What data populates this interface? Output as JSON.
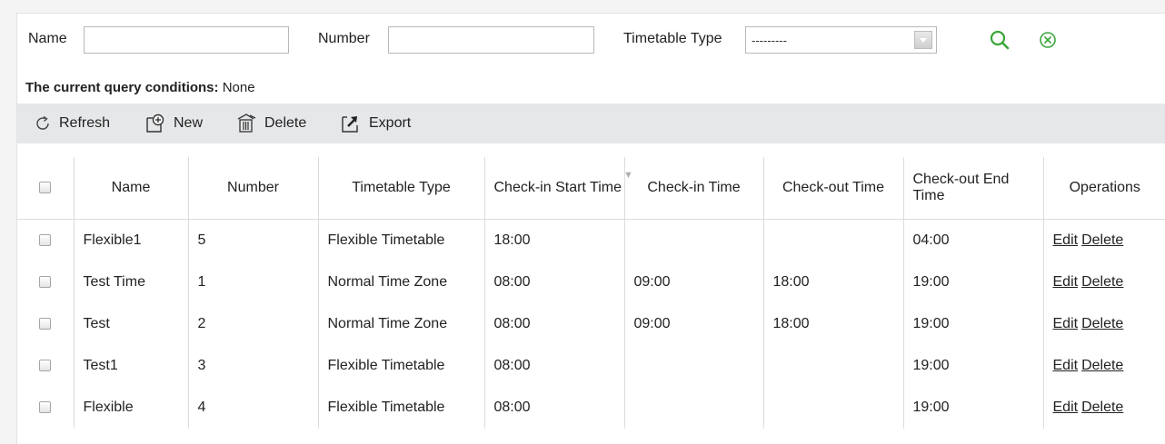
{
  "filters": {
    "name_label": "Name",
    "name_value": "",
    "number_label": "Number",
    "number_value": "",
    "timetable_type_label": "Timetable Type",
    "timetable_type_value": "---------"
  },
  "query_conditions": {
    "label": "The current query conditions:",
    "value": "None"
  },
  "toolbar": {
    "refresh": "Refresh",
    "new": "New",
    "delete": "Delete",
    "export": "Export"
  },
  "table": {
    "headers": {
      "name": "Name",
      "number": "Number",
      "timetable_type": "Timetable Type",
      "checkin_start": "Check-in Start Time",
      "checkin": "Check-in Time",
      "checkout": "Check-out Time",
      "checkout_end": "Check-out End Time",
      "operations": "Operations"
    },
    "rows": [
      {
        "name": "Flexible1",
        "number": "5",
        "type": "Flexible Timetable",
        "checkin_start": "18:00",
        "checkin": "",
        "checkout": "",
        "checkout_end": "04:00",
        "edit": "Edit",
        "delete": "Delete"
      },
      {
        "name": "Test Time",
        "number": "1",
        "type": "Normal Time Zone",
        "checkin_start": "08:00",
        "checkin": "09:00",
        "checkout": "18:00",
        "checkout_end": "19:00",
        "edit": "Edit",
        "delete": "Delete"
      },
      {
        "name": "Test",
        "number": "2",
        "type": "Normal Time Zone",
        "checkin_start": "08:00",
        "checkin": "09:00",
        "checkout": "18:00",
        "checkout_end": "19:00",
        "edit": "Edit",
        "delete": "Delete"
      },
      {
        "name": "Test1",
        "number": "3",
        "type": "Flexible Timetable",
        "checkin_start": "08:00",
        "checkin": "",
        "checkout": "",
        "checkout_end": "19:00",
        "edit": "Edit",
        "delete": "Delete"
      },
      {
        "name": "Flexible",
        "number": "4",
        "type": "Flexible Timetable",
        "checkin_start": "08:00",
        "checkin": "",
        "checkout": "",
        "checkout_end": "19:00",
        "edit": "Edit",
        "delete": "Delete"
      }
    ]
  },
  "icons": {
    "search": "search-icon",
    "clear": "clear-icon",
    "refresh": "refresh-icon",
    "new": "new-icon",
    "delete": "delete-icon",
    "export": "export-icon",
    "sort": "sort-arrow-icon"
  },
  "colors": {
    "accent_green": "#3aa63a",
    "toolbar_bg": "#e6e7e9"
  }
}
